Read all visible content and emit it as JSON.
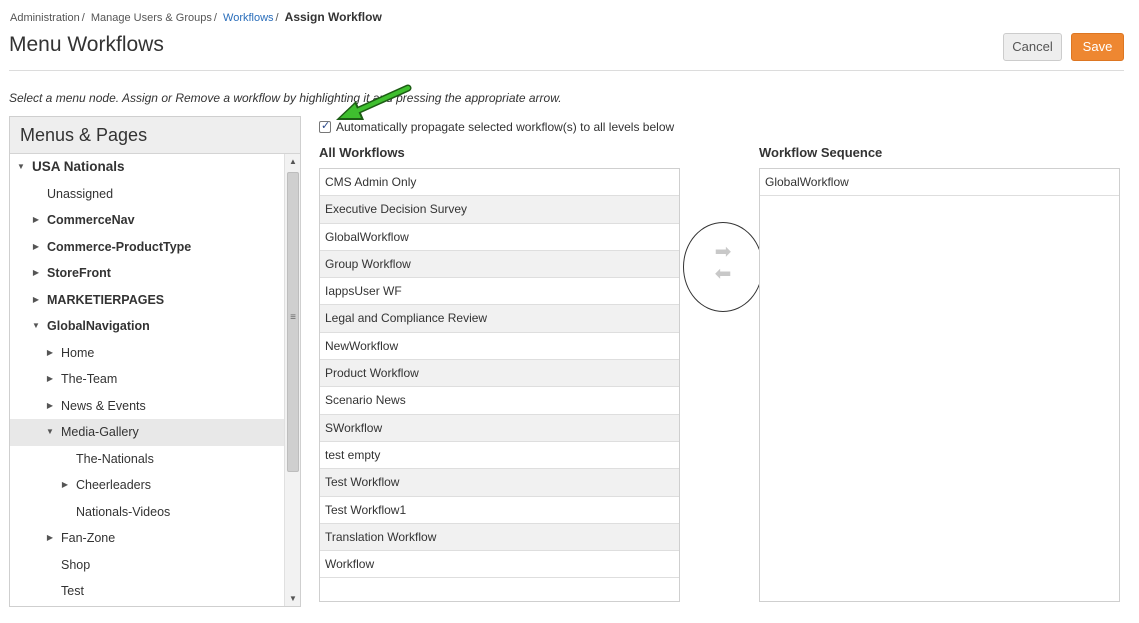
{
  "breadcrumb": {
    "items": [
      "Administration",
      "Manage Users & Groups",
      "Workflows"
    ],
    "current": "Assign Workflow"
  },
  "page": {
    "title": "Menu Workflows"
  },
  "actions": {
    "cancel_label": "Cancel",
    "save_label": "Save"
  },
  "instruction": "Select a menu node. Assign or Remove a workflow by highlighting it and pressing the appropriate arrow.",
  "tree": {
    "title": "Menus & Pages",
    "nodes": [
      {
        "label": "USA Nationals",
        "level": 0,
        "expander": "expanded",
        "bold": true
      },
      {
        "label": "Unassigned",
        "level": 1,
        "expander": "none",
        "bold": false
      },
      {
        "label": "CommerceNav",
        "level": 1,
        "expander": "collapsed",
        "bold": true
      },
      {
        "label": "Commerce-ProductType",
        "level": 1,
        "expander": "collapsed",
        "bold": true
      },
      {
        "label": "StoreFront",
        "level": 1,
        "expander": "collapsed",
        "bold": true
      },
      {
        "label": "MARKETIERPAGES",
        "level": 1,
        "expander": "collapsed",
        "bold": true
      },
      {
        "label": "GlobalNavigation",
        "level": 1,
        "expander": "expanded",
        "bold": true
      },
      {
        "label": "Home",
        "level": 2,
        "expander": "collapsed",
        "bold": false
      },
      {
        "label": "The-Team",
        "level": 2,
        "expander": "collapsed",
        "bold": false
      },
      {
        "label": "News & Events",
        "level": 2,
        "expander": "collapsed",
        "bold": false
      },
      {
        "label": "Media-Gallery",
        "level": 2,
        "expander": "expanded",
        "bold": false,
        "selected": true
      },
      {
        "label": "The-Nationals",
        "level": 3,
        "expander": "none",
        "bold": false
      },
      {
        "label": "Cheerleaders",
        "level": 3,
        "expander": "collapsed",
        "bold": false
      },
      {
        "label": "Nationals-Videos",
        "level": 3,
        "expander": "none",
        "bold": false
      },
      {
        "label": "Fan-Zone",
        "level": 2,
        "expander": "collapsed",
        "bold": false
      },
      {
        "label": "Shop",
        "level": 2,
        "expander": "none",
        "bold": false
      },
      {
        "label": "Test",
        "level": 2,
        "expander": "none",
        "bold": false
      }
    ]
  },
  "propagate": {
    "label": "Automatically propagate selected workflow(s) to all levels below",
    "checked": true
  },
  "all_workflows": {
    "title": "All Workflows",
    "items": [
      "CMS Admin Only",
      "Executive Decision Survey",
      "GlobalWorkflow",
      "Group Workflow",
      "IappsUser WF",
      "Legal and Compliance Review",
      "NewWorkflow",
      "Product Workflow",
      "Scenario News",
      "SWorkflow",
      "test empty",
      "Test Workflow",
      "Test Workflow1",
      "Translation Workflow",
      "Workflow"
    ]
  },
  "workflow_sequence": {
    "title": "Workflow Sequence",
    "items": [
      "GlobalWorkflow"
    ]
  },
  "icons": {
    "assign": "arrow-right-icon",
    "remove": "arrow-left-icon",
    "annotation": "green-pointer-arrow"
  },
  "colors": {
    "save": "#ee8731",
    "link": "#2a6ebb",
    "annotation_arrow": "#3fbf2f"
  }
}
